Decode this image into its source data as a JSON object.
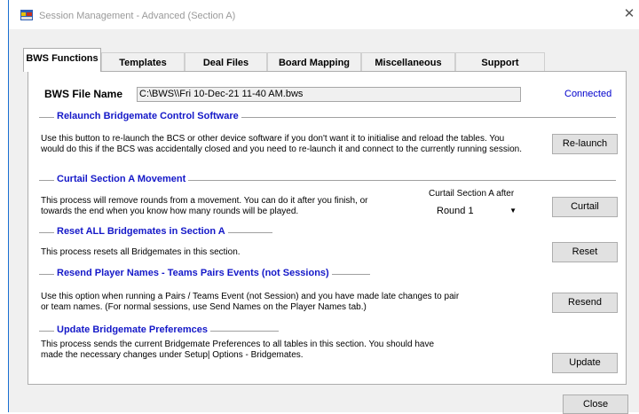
{
  "window": {
    "title": "Session Management - Advanced (Section A)",
    "close_glyph": "✕"
  },
  "tabs": [
    {
      "label": "BWS Functions",
      "active": true
    },
    {
      "label": "Templates",
      "active": false
    },
    {
      "label": "Deal Files",
      "active": false
    },
    {
      "label": "Board Mapping",
      "active": false
    },
    {
      "label": "Miscellaneous",
      "active": false
    },
    {
      "label": "Support",
      "active": false
    }
  ],
  "bws": {
    "label": "BWS File Name",
    "value": "C:\\BWS\\\\Fri 10-Dec-21 11-40 AM.bws",
    "status": "Connected"
  },
  "sections": {
    "relaunch": {
      "title": "Relaunch Bridgemate Control Software",
      "line1": "Use this button to re-launch the BCS or other device software if you don't want it to initialise and reload the tables. You",
      "line2": "would  do this if the BCS was accidentally closed and you need to re-launch it and connect to the currently running session.",
      "button": "Re-launch"
    },
    "curtail": {
      "title": "Curtail Section A Movement",
      "line1": "This process will remove rounds from a movement. You can do it after you finish, or",
      "line2": "towards the end when you know how many rounds will be played.",
      "after_label": "Curtail Section A after",
      "selected": "Round 1",
      "button": "Curtail"
    },
    "reset": {
      "title": "Reset ALL Bridgemates in Section A",
      "line1": "This process resets all Bridgemates in this section.",
      "button": "Reset"
    },
    "resend": {
      "title": "Resend Player Names - Teams Pairs Events (not Sessions)",
      "line1": "Use this option when running a Pairs / Teams Event (not Session) and you have made late changes to pair",
      "line2": "or team names. (For normal sessions, use Send Names on the Player Names tab.)",
      "button": "Resend"
    },
    "update": {
      "title": "Update Bridgemate Preferemces",
      "line1": "This process sends the current Bridgemate Preferences to all tables in this section. You should have",
      "line2": "made the necessary changes under Setup| Options - Bridgemates.",
      "button": "Update"
    }
  },
  "footer": {
    "close_button": "Close"
  },
  "colors": {
    "section_title": "#1418c8",
    "connected": "#0000cc",
    "window_border": "#1a6fd1"
  },
  "icons": {
    "app": "app-window-icon",
    "close": "close-icon",
    "dropdown": "chevron-down-icon"
  }
}
